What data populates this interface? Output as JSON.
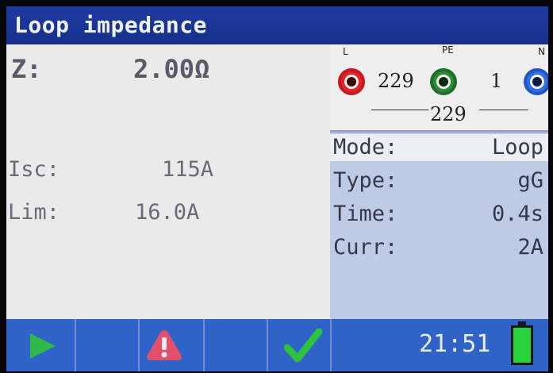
{
  "title": "Loop impedance",
  "results": {
    "z_label": "Z:",
    "z_value": "2.00Ω",
    "isc_label": "Isc:",
    "isc_value": "115A",
    "lim_label": "Lim:",
    "lim_value": "16.0A"
  },
  "terminals": {
    "l_label": "L",
    "pe_label": "PE",
    "n_label": "N",
    "l_pe_voltage": "229",
    "pe_n_voltage": "1",
    "l_n_voltage": "229"
  },
  "params": [
    {
      "label": "Mode:",
      "value": "Loop",
      "selected": true
    },
    {
      "label": "Type:",
      "value": "gG",
      "selected": false
    },
    {
      "label": "Time:",
      "value": "0.4s",
      "selected": false
    },
    {
      "label": "Curr:",
      "value": "2A",
      "selected": false
    }
  ],
  "status": {
    "time": "21:51",
    "battery_level": 1.0
  },
  "icons": {
    "start": "play-icon",
    "warning": "warning-icon",
    "pass": "checkmark-icon",
    "battery": "battery-icon"
  },
  "colors": {
    "title_bar": "#1e3aa0",
    "bottom_bar": "#2f63c8",
    "right_panel": "#bfcbe4",
    "terminal_l": "#e0242a",
    "terminal_pe": "#2e8b3a",
    "terminal_n": "#2f6fe0",
    "play": "#2fb84a",
    "warning": "#e0506a",
    "check": "#2fc23e",
    "battery": "#27d23a"
  }
}
